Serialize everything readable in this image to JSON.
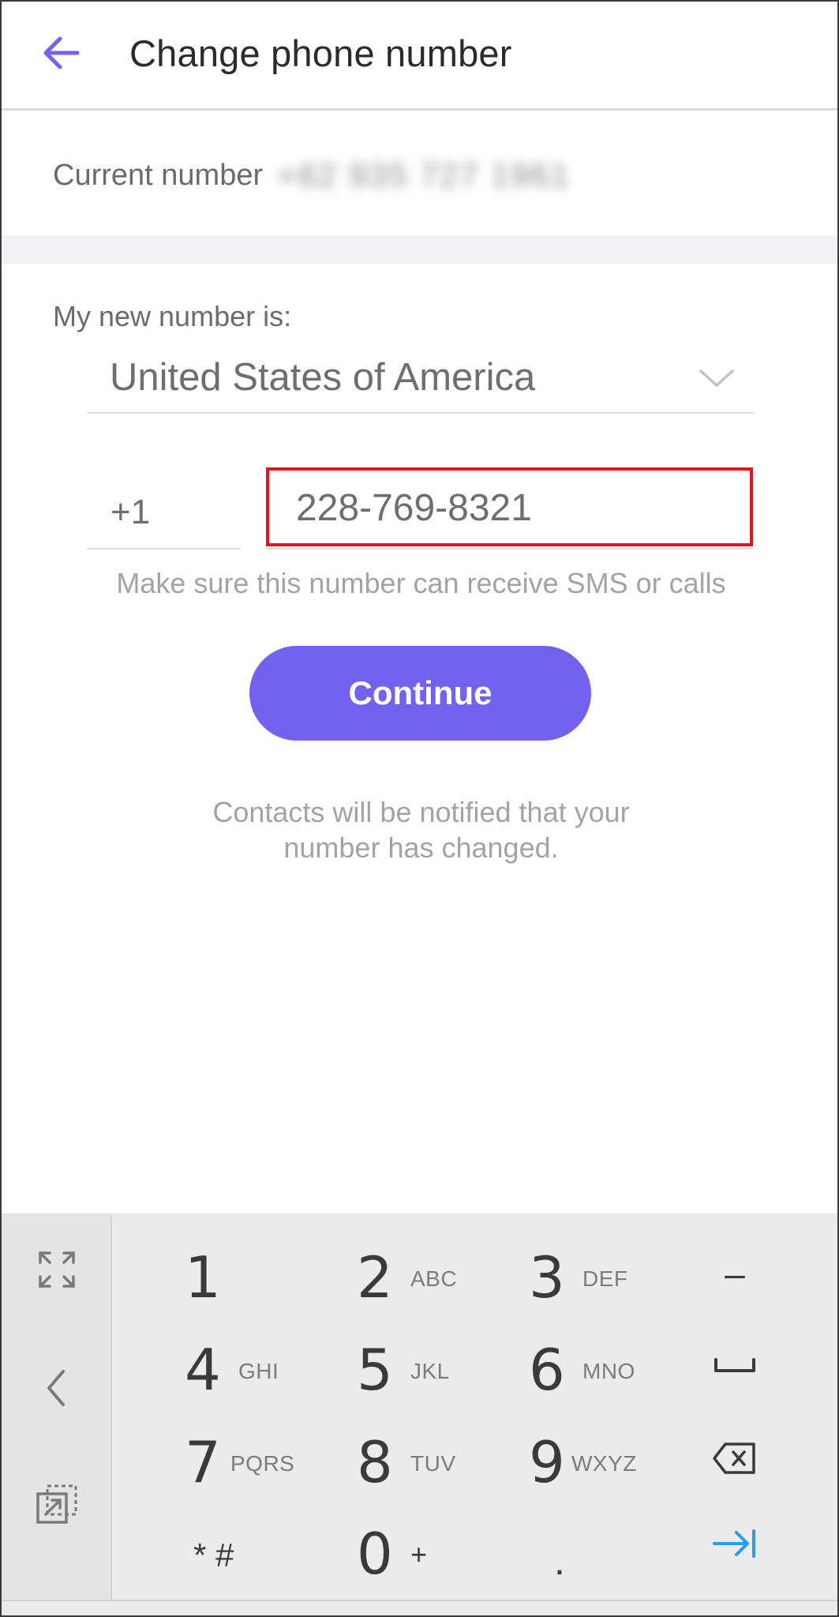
{
  "header": {
    "title": "Change phone number",
    "back_icon": "arrow-left-icon",
    "accent_color": "#7361ef"
  },
  "current": {
    "label": "Current number",
    "value": "+62 935 727 1961"
  },
  "form": {
    "new_label": "My new number is:",
    "country": "United States of America",
    "country_code": "+1",
    "phone_value": "228-769-8321",
    "hint": "Make sure this number can receive SMS or calls",
    "continue_label": "Continue",
    "notice_line1": "Contacts will be notified that your",
    "notice_line2": "number has changed."
  },
  "keyboard": {
    "rows": [
      [
        {
          "digit": "1",
          "letters": ""
        },
        {
          "digit": "2",
          "letters": "ABC"
        },
        {
          "digit": "3",
          "letters": "DEF"
        }
      ],
      [
        {
          "digit": "4",
          "letters": "GHI"
        },
        {
          "digit": "5",
          "letters": "JKL"
        },
        {
          "digit": "6",
          "letters": "MNO"
        }
      ],
      [
        {
          "digit": "7",
          "letters": "PQRS"
        },
        {
          "digit": "8",
          "letters": "TUV"
        },
        {
          "digit": "9",
          "letters": "WXYZ"
        }
      ]
    ],
    "bottom": {
      "star_hash": "* #",
      "zero": "0",
      "plus": "+",
      "dot": "."
    },
    "side_icons": [
      "expand-icon",
      "chevron-left-icon",
      "floating-keyboard-icon"
    ],
    "function_keys": [
      "minus",
      "space-icon",
      "backspace-icon",
      "next-field-icon"
    ],
    "minus": "–",
    "next_color": "#2e9be6"
  }
}
